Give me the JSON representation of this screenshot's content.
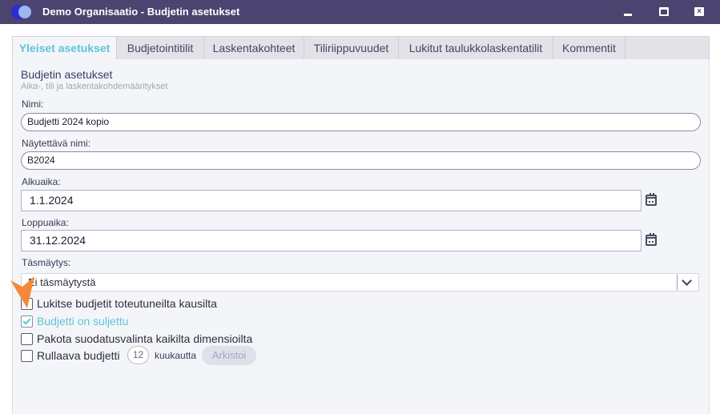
{
  "window": {
    "title": "Demo Organisaatio - Budjetin asetukset",
    "close_glyph": "×",
    "logo_icon": "app-logo-icon",
    "minimize_icon": "minimize-icon",
    "maximize_icon": "maximize-icon",
    "close_icon": "close-icon"
  },
  "tabs": [
    {
      "label": "Yleiset asetukset",
      "active": true
    },
    {
      "label": "Budjetointitilit",
      "active": false
    },
    {
      "label": "Laskentakohteet",
      "active": false
    },
    {
      "label": "Tiliriippuvuudet",
      "active": false
    },
    {
      "label": "Lukitut taulukkolaskentatilit",
      "active": false
    },
    {
      "label": "Kommentit",
      "active": false
    }
  ],
  "section": {
    "title": "Budjetin asetukset",
    "subtitle": "Aika-, tili ja laskentakohdemääritykset"
  },
  "fields": {
    "name": {
      "label": "Nimi:",
      "value": "Budjetti 2024 kopio"
    },
    "display_name": {
      "label": "Näytettävä nimi:",
      "value": "B2024"
    },
    "start_date": {
      "label": "Alkuaika:",
      "value": "1.1.2024"
    },
    "end_date": {
      "label": "Loppuaika:",
      "value": "31.12.2024"
    },
    "reconciliation": {
      "label": "Täsmäytys:",
      "value": "Ei täsmäytystä"
    }
  },
  "checkboxes": [
    {
      "label": "Lukitse budjetit toteutuneilta kausilta",
      "checked": false
    },
    {
      "label": "Budjetti on suljettu",
      "checked": true
    },
    {
      "label": "Pakota suodatusvalinta kaikilta dimensioilta",
      "checked": false
    },
    {
      "label": "Rullaava budjetti",
      "checked": false
    }
  ],
  "rolling": {
    "months": "12",
    "unit": "kuukautta",
    "archive_label": "Arkistoi"
  },
  "colors": {
    "titlebar": "#4b4370",
    "accent": "#5cc6d6",
    "pointer": "#f5883a"
  }
}
